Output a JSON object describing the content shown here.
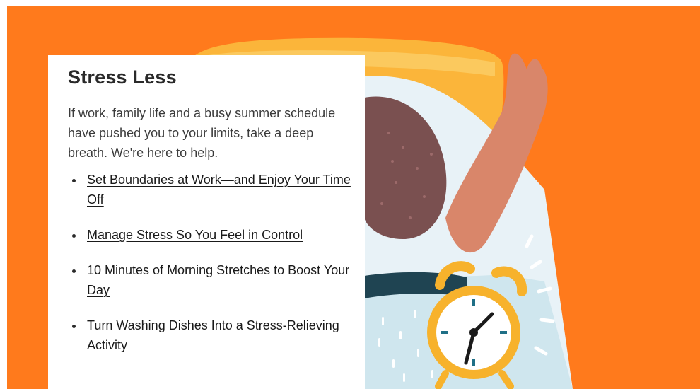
{
  "promo": {
    "title": "Stress Less",
    "intro": "If work, family life and a busy summer schedule have pushed you to your limits, take a deep breath. We're here to help.",
    "links": [
      {
        "label": "Set Boundaries at Work—and Enjoy Your Time Off"
      },
      {
        "label": "Manage Stress So You Feel in Control"
      },
      {
        "label": "10 Minutes of Morning Stretches to Boost Your Day"
      },
      {
        "label": "Turn Washing Dishes Into a Stress-Relieving Activity"
      }
    ]
  },
  "illustration": {
    "subject": "woman-in-bed-with-alarm-clock",
    "colors": {
      "background": "#ff7a1c",
      "pillow": "#fbb53a",
      "sheet": "#e8f2f7",
      "blanket": "#cfe6ee",
      "hair": "#7a5050",
      "skin": "#d9866a",
      "clock": "#f7b22c",
      "blanket_stripe": "#1f4452"
    }
  }
}
